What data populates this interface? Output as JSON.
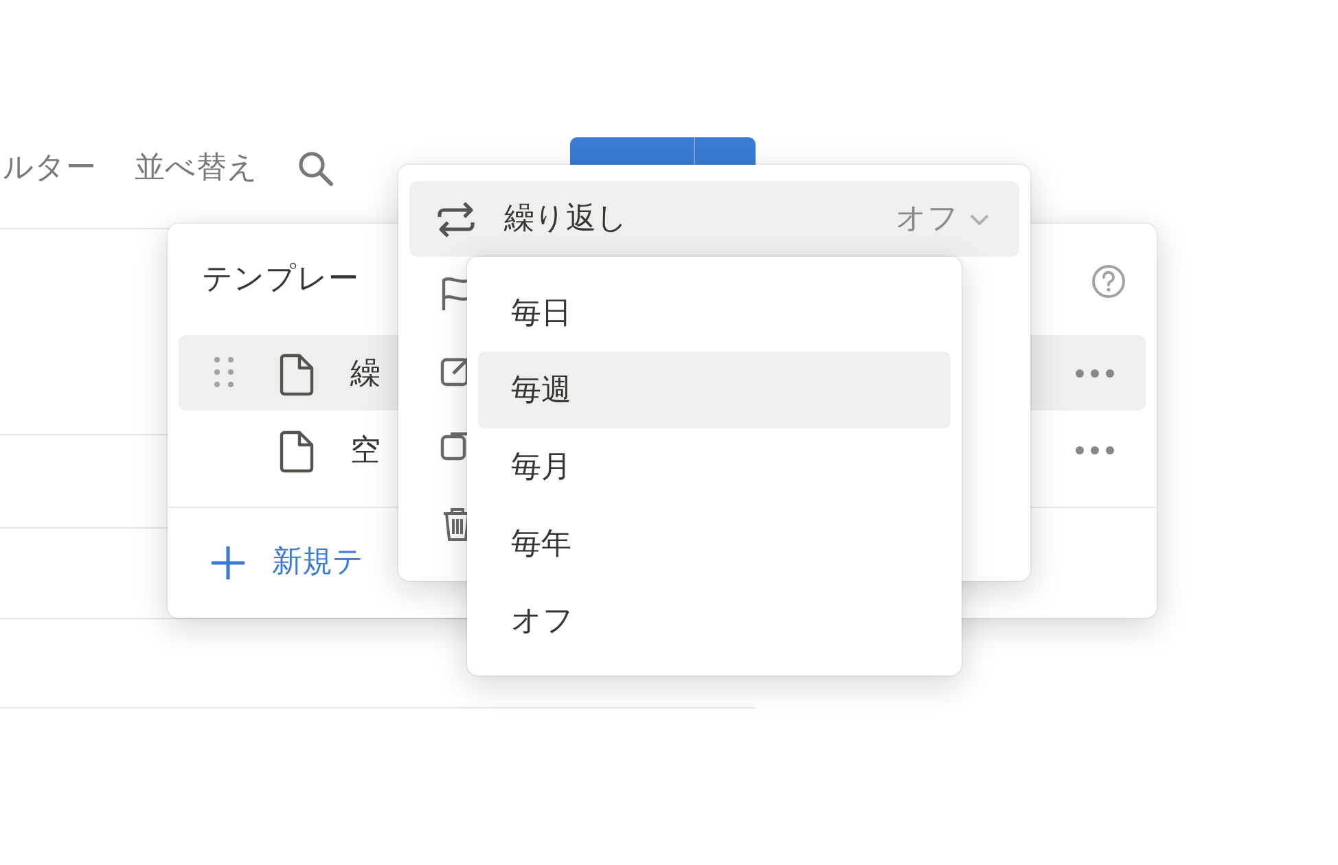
{
  "toolbar": {
    "items": [
      {
        "kind": "text",
        "label": "ルター"
      },
      {
        "kind": "text",
        "label": "並べ替え"
      },
      {
        "kind": "search"
      }
    ],
    "new_button": {
      "split": true
    }
  },
  "templates_panel": {
    "title": "テンプレー",
    "rows": [
      {
        "label": "繰",
        "selected": true,
        "draggable": true
      },
      {
        "label": "空",
        "selected": false,
        "draggable": false
      }
    ],
    "add_label": "新規テ"
  },
  "options_menu": {
    "header": {
      "label": "繰り返し",
      "value": "オフ"
    }
  },
  "repeat_menu": {
    "options": [
      {
        "label": "毎日",
        "selected": false
      },
      {
        "label": "毎週",
        "selected": true
      },
      {
        "label": "毎月",
        "selected": false
      },
      {
        "label": "毎年",
        "selected": false
      },
      {
        "label": "オフ",
        "selected": false
      }
    ]
  }
}
